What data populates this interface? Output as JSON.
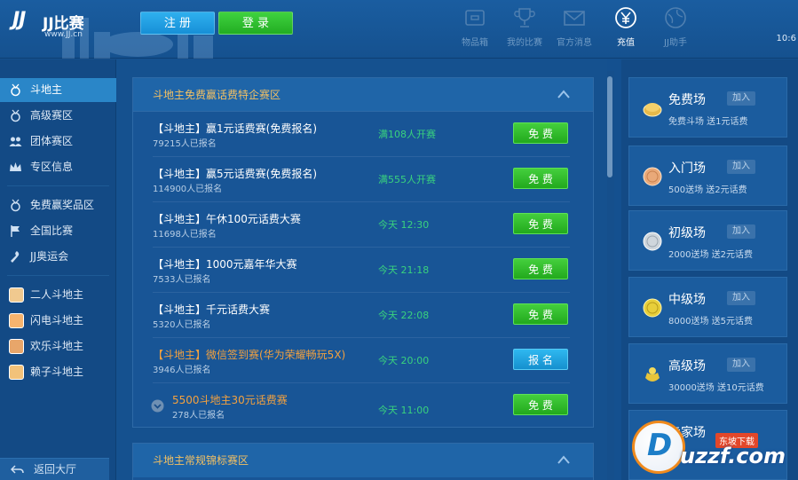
{
  "header": {
    "logo_mark": "JJ",
    "logo_title": "JJ比赛",
    "logo_url": "www.JJ.cn",
    "register_label": "注 册",
    "login_label": "登 录",
    "clock": "10:6",
    "nav": [
      {
        "label": "物品箱",
        "icon": "box-icon"
      },
      {
        "label": "我的比赛",
        "icon": "trophy-icon"
      },
      {
        "label": "官方消息",
        "icon": "mail-icon"
      },
      {
        "label": "充值",
        "icon": "yen-icon"
      },
      {
        "label": "JJ助手",
        "icon": "globe-icon"
      }
    ]
  },
  "sidebar": {
    "items": [
      {
        "label": "斗地主",
        "icon": "medal-icon"
      },
      {
        "label": "高级赛区",
        "icon": "medal-icon"
      },
      {
        "label": "团体赛区",
        "icon": "group-icon"
      },
      {
        "label": "专区信息",
        "icon": "crown-icon"
      },
      {
        "label": "免费赢奖品区",
        "icon": "medal-icon"
      },
      {
        "label": "全国比赛",
        "icon": "flag-icon"
      },
      {
        "label": "JJ奥运会",
        "icon": "torch-icon"
      },
      {
        "label": "二人斗地主",
        "icon": "avatar"
      },
      {
        "label": "闪电斗地主",
        "icon": "avatar"
      },
      {
        "label": "欢乐斗地主",
        "icon": "avatar"
      },
      {
        "label": "赖子斗地主",
        "icon": "avatar"
      }
    ],
    "back_label": "返回大厅"
  },
  "main": {
    "panel_title": "斗地主免费赢话费特企赛区",
    "rows": [
      {
        "title": "【斗地主】赢1元话费赛(免费报名)",
        "sub": "79215人已报名",
        "time": "满108人开赛",
        "btn": "免 费",
        "btn_style": "green",
        "title_style": "white"
      },
      {
        "title": "【斗地主】赢5元话费赛(免费报名)",
        "sub": "114900人已报名",
        "time": "满555人开赛",
        "btn": "免 费",
        "btn_style": "green",
        "title_style": "white"
      },
      {
        "title": "【斗地主】午休100元话费大赛",
        "sub": "11698人已报名",
        "time": "今天 12:30",
        "btn": "免 费",
        "btn_style": "green",
        "title_style": "white"
      },
      {
        "title": "【斗地主】1000元嘉年华大赛",
        "sub": "7533人已报名",
        "time": "今天 21:18",
        "btn": "免 费",
        "btn_style": "green",
        "title_style": "white"
      },
      {
        "title": "【斗地主】千元话费大赛",
        "sub": "5320人已报名",
        "time": "今天 22:08",
        "btn": "免 费",
        "btn_style": "green",
        "title_style": "white"
      },
      {
        "title": "【斗地主】微信签到赛(华为荣耀畅玩5X)",
        "sub": "3946人已报名",
        "time": "今天 20:00",
        "btn": "报 名",
        "btn_style": "blue",
        "title_style": "orange"
      },
      {
        "title": "5500斗地主30元话费赛",
        "sub": "278人已报名",
        "time": "今天 11:00",
        "btn": "免 费",
        "btn_style": "green",
        "title_style": "orange",
        "collapsible": true
      }
    ],
    "panel2_title": "斗地主常规锦标赛区"
  },
  "right": {
    "cards": [
      {
        "title": "免费场",
        "join": "加入",
        "sub": "免费斗场 送1元话费",
        "coin_color": "#e6b94a"
      },
      {
        "title": "入门场",
        "join": "加入",
        "sub": "500送场 送2元话费",
        "coin_color": "#e9a979"
      },
      {
        "title": "初级场",
        "join": "加入",
        "sub": "2000送场 送2元话费",
        "coin_color": "#cfd6dc"
      },
      {
        "title": "中级场",
        "join": "加入",
        "sub": "8000送场 送5元话费",
        "coin_color": "#e8cf3a"
      },
      {
        "title": "高级场",
        "join": "加入",
        "sub": "30000送场 送10元话费",
        "coin_color": "#e8c53a"
      },
      {
        "title": "专家场",
        "join": "加入",
        "sub": "",
        "coin_color": "#e8c53a"
      }
    ]
  },
  "watermark": {
    "brand": "uzzf.com",
    "tag": "东坡下载"
  }
}
